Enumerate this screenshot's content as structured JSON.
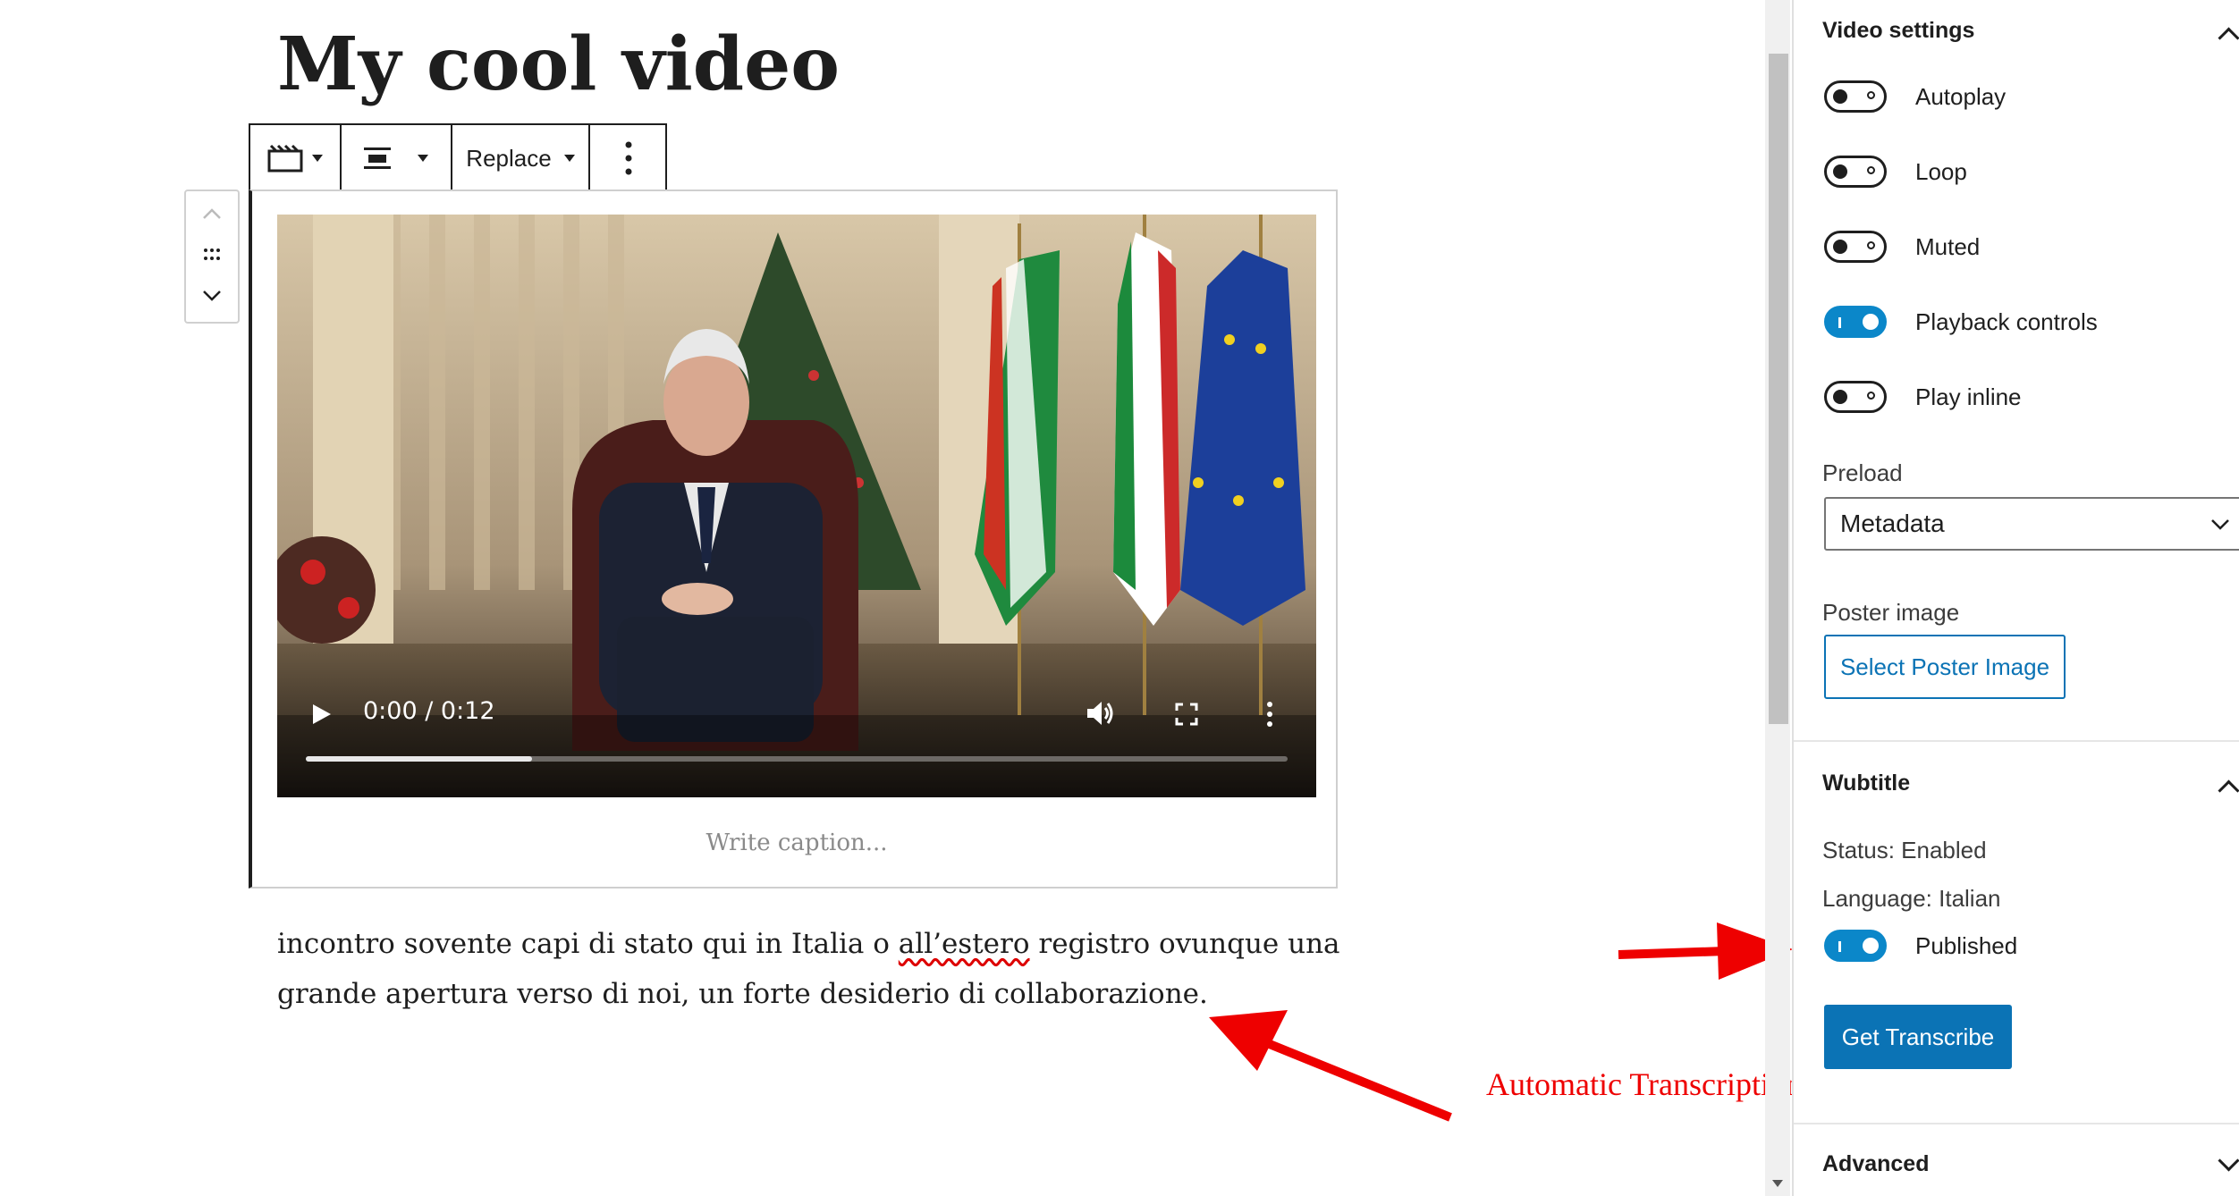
{
  "post": {
    "title": "My cool video",
    "caption_placeholder": "Write caption...",
    "transcript_before": "incontro sovente capi di stato qui in Italia o ",
    "transcript_misspelled": "all’estero",
    "transcript_after": " registro ovunque una grande apertura verso di noi, un forte desiderio di collaborazione."
  },
  "toolbar": {
    "replace_label": "Replace",
    "icons": [
      "video-block-icon",
      "align-center-icon",
      "more-options-icon"
    ]
  },
  "video": {
    "time": "0:00 / 0:12",
    "progress": 0.23
  },
  "annotation": {
    "text": "Automatic Transcription",
    "color": "#ff0000"
  },
  "sidebar": {
    "video_settings": {
      "title": "Video settings",
      "toggles": [
        {
          "label": "Autoplay",
          "on": false
        },
        {
          "label": "Loop",
          "on": false
        },
        {
          "label": "Muted",
          "on": false
        },
        {
          "label": "Playback controls",
          "on": true
        },
        {
          "label": "Play inline",
          "on": false
        }
      ],
      "preload_label": "Preload",
      "preload_value": "Metadata",
      "poster_label": "Poster image",
      "poster_button": "Select Poster Image"
    },
    "wubtitle": {
      "title": "Wubtitle",
      "status": "Status: Enabled",
      "language": "Language: Italian",
      "published_label": "Published",
      "published_on": true,
      "button": "Get Transcribe"
    },
    "advanced": {
      "title": "Advanced"
    }
  },
  "colors": {
    "accent": "#0b87c9",
    "primary_button": "#0b73b5",
    "annotation": "#ff0000"
  }
}
